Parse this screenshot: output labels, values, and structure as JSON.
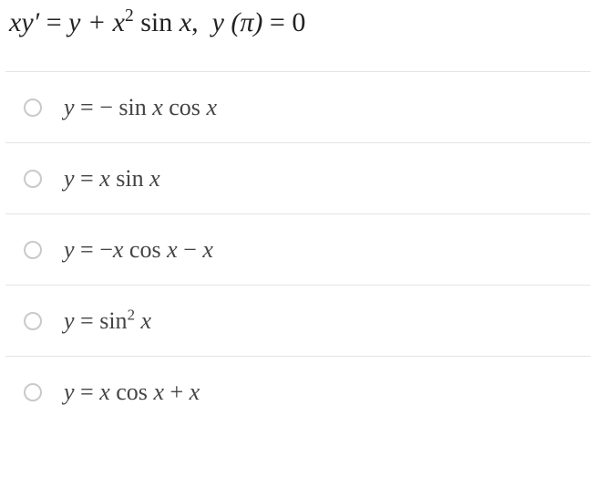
{
  "question": {
    "lhs": "xy′",
    "eq1": " = ",
    "rhs": "y + x",
    "exp": "2",
    "sinpart": " sin x,  ",
    "condL": "y (π)",
    "condEq": " = ",
    "condR": "0"
  },
  "options": [
    {
      "pre": "y = − ",
      "fn": "sin x cos x",
      "post": ""
    },
    {
      "pre": "y = x ",
      "fn": "sin x",
      "post": ""
    },
    {
      "pre": "y = −x ",
      "fn": "cos x",
      "post": " − x"
    },
    {
      "pre": "y = ",
      "fn": "sin",
      "exp": "2",
      "fn2": " x",
      "post": ""
    },
    {
      "pre": "y = x ",
      "fn": "cos x",
      "post": " + x"
    }
  ]
}
